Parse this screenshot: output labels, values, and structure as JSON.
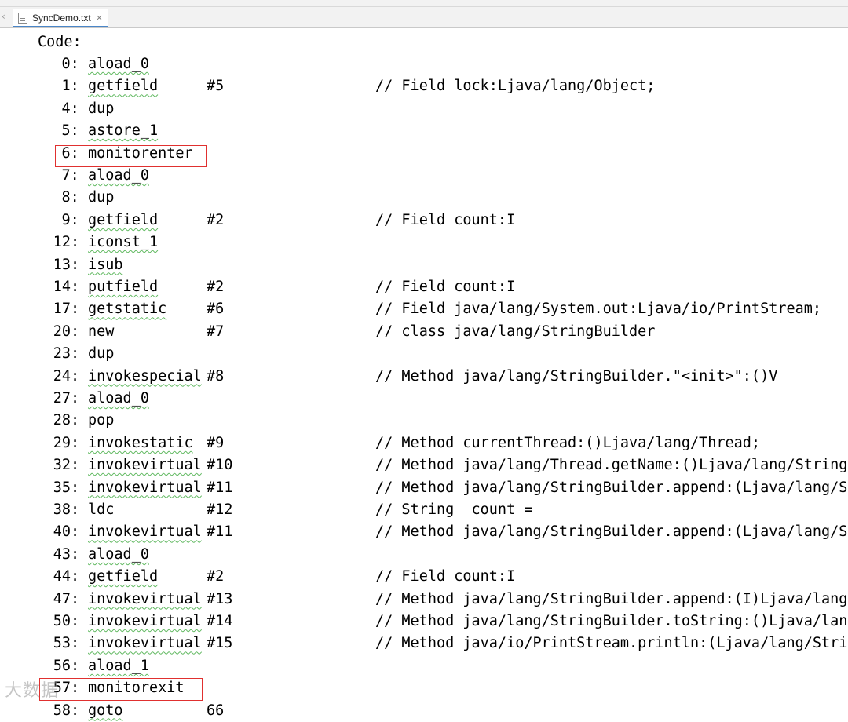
{
  "tab": {
    "label": "SyncDemo.txt",
    "close": "×",
    "scroll_left": "‹"
  },
  "header": "Code:",
  "instructions": [
    {
      "offset": "0:",
      "op": "aload_0",
      "arg": "",
      "comment": ""
    },
    {
      "offset": "1:",
      "op": "getfield",
      "arg": "#5",
      "comment": "// Field lock:Ljava/lang/Object;"
    },
    {
      "offset": "4:",
      "op": "dup",
      "arg": "",
      "comment": ""
    },
    {
      "offset": "5:",
      "op": "astore_1",
      "arg": "",
      "comment": ""
    },
    {
      "offset": "6:",
      "op": "monitorenter",
      "arg": "",
      "comment": ""
    },
    {
      "offset": "7:",
      "op": "aload_0",
      "arg": "",
      "comment": ""
    },
    {
      "offset": "8:",
      "op": "dup",
      "arg": "",
      "comment": ""
    },
    {
      "offset": "9:",
      "op": "getfield",
      "arg": "#2",
      "comment": "// Field count:I"
    },
    {
      "offset": "12:",
      "op": "iconst_1",
      "arg": "",
      "comment": ""
    },
    {
      "offset": "13:",
      "op": "isub",
      "arg": "",
      "comment": ""
    },
    {
      "offset": "14:",
      "op": "putfield",
      "arg": "#2",
      "comment": "// Field count:I"
    },
    {
      "offset": "17:",
      "op": "getstatic",
      "arg": "#6",
      "comment": "// Field java/lang/System.out:Ljava/io/PrintStream;"
    },
    {
      "offset": "20:",
      "op": "new",
      "arg": "#7",
      "comment": "// class java/lang/StringBuilder"
    },
    {
      "offset": "23:",
      "op": "dup",
      "arg": "",
      "comment": ""
    },
    {
      "offset": "24:",
      "op": "invokespecial",
      "arg": "#8",
      "comment": "// Method java/lang/StringBuilder.\"<init>\":()V"
    },
    {
      "offset": "27:",
      "op": "aload_0",
      "arg": "",
      "comment": ""
    },
    {
      "offset": "28:",
      "op": "pop",
      "arg": "",
      "comment": ""
    },
    {
      "offset": "29:",
      "op": "invokestatic",
      "arg": "#9",
      "comment": "// Method currentThread:()Ljava/lang/Thread;"
    },
    {
      "offset": "32:",
      "op": "invokevirtual",
      "arg": "#10",
      "comment": "// Method java/lang/Thread.getName:()Ljava/lang/String;"
    },
    {
      "offset": "35:",
      "op": "invokevirtual",
      "arg": "#11",
      "comment": "// Method java/lang/StringBuilder.append:(Ljava/lang/Str"
    },
    {
      "offset": "38:",
      "op": "ldc",
      "arg": "#12",
      "comment": "// String  count ="
    },
    {
      "offset": "40:",
      "op": "invokevirtual",
      "arg": "#11",
      "comment": "// Method java/lang/StringBuilder.append:(Ljava/lang/Str"
    },
    {
      "offset": "43:",
      "op": "aload_0",
      "arg": "",
      "comment": ""
    },
    {
      "offset": "44:",
      "op": "getfield",
      "arg": "#2",
      "comment": "// Field count:I"
    },
    {
      "offset": "47:",
      "op": "invokevirtual",
      "arg": "#13",
      "comment": "// Method java/lang/StringBuilder.append:(I)Ljava/lang/S"
    },
    {
      "offset": "50:",
      "op": "invokevirtual",
      "arg": "#14",
      "comment": "// Method java/lang/StringBuilder.toString:()Ljava/lang/"
    },
    {
      "offset": "53:",
      "op": "invokevirtual",
      "arg": "#15",
      "comment": "// Method java/io/PrintStream.println:(Ljava/lang/String"
    },
    {
      "offset": "56:",
      "op": "aload_1",
      "arg": "",
      "comment": ""
    },
    {
      "offset": "57:",
      "op": "monitorexit",
      "arg": "",
      "comment": ""
    },
    {
      "offset": "58:",
      "op": "goto",
      "arg": "66",
      "comment": ""
    }
  ],
  "highlighted_ops": [
    "monitorenter",
    "monitorexit"
  ],
  "colors": {
    "highlight_box": "#e0302f",
    "squiggle": "#5fb85f",
    "tab_accent": "#4a86c8"
  },
  "watermark": "大数据"
}
